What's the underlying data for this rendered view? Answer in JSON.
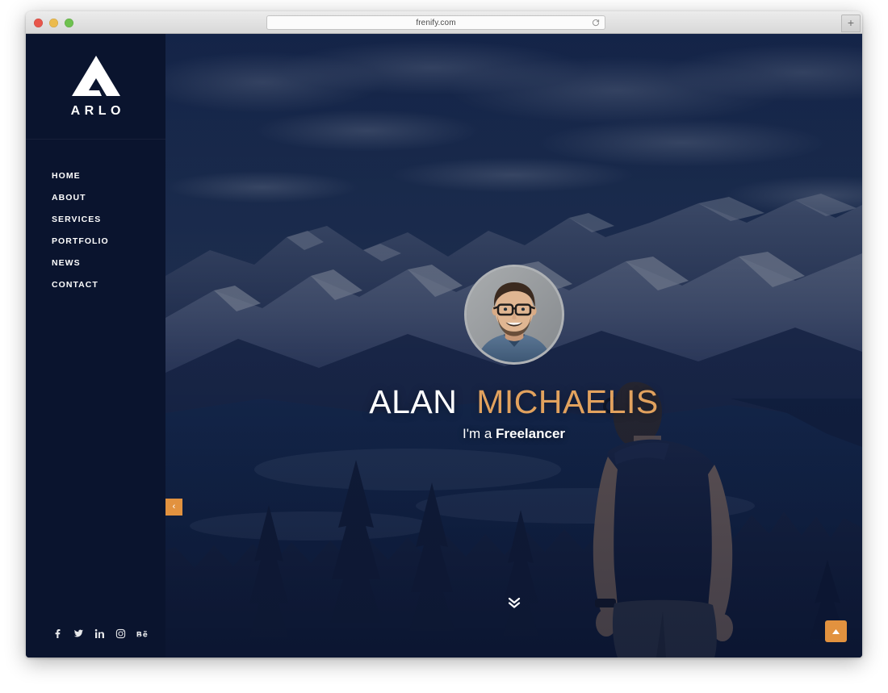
{
  "browser": {
    "url": "frenify.com",
    "reload_icon": "reload-icon",
    "new_tab_label": "+",
    "traffic_lights": [
      "close",
      "minimize",
      "maximize"
    ]
  },
  "colors": {
    "sidebar_bg": "#0a142e",
    "accent_orange": "#e2923f",
    "title_accent": "#e2a25e",
    "text_white": "#ffffff"
  },
  "sidebar": {
    "logo": {
      "mark_icon": "arlo-triangle-logo-icon",
      "text": "ARLO"
    },
    "nav_items": [
      {
        "label": "HOME"
      },
      {
        "label": "ABOUT"
      },
      {
        "label": "SERVICES"
      },
      {
        "label": "PORTFOLIO"
      },
      {
        "label": "NEWS"
      },
      {
        "label": "CONTACT"
      }
    ],
    "social_links": [
      {
        "name": "facebook",
        "glyph": "f"
      },
      {
        "name": "twitter",
        "glyph": "twitter-bird"
      },
      {
        "name": "linkedin",
        "glyph": "in"
      },
      {
        "name": "instagram",
        "glyph": "camera"
      },
      {
        "name": "behance",
        "glyph": "Be"
      }
    ],
    "collapse_tab": {
      "icon": "chevron-left-icon",
      "glyph": "‹"
    }
  },
  "hero": {
    "avatar": {
      "alt": "portrait-photo-of-man-with-glasses"
    },
    "title_first": "ALAN",
    "title_last": "MICHAELIS",
    "subtitle_prefix": "I'm a ",
    "subtitle_strong": "Freelancer",
    "scroll_indicator_icon": "double-chevron-down-icon",
    "background_alt": "mountain-lake-landscape-with-hiker"
  },
  "back_to_top": {
    "icon": "chevron-up-icon"
  }
}
